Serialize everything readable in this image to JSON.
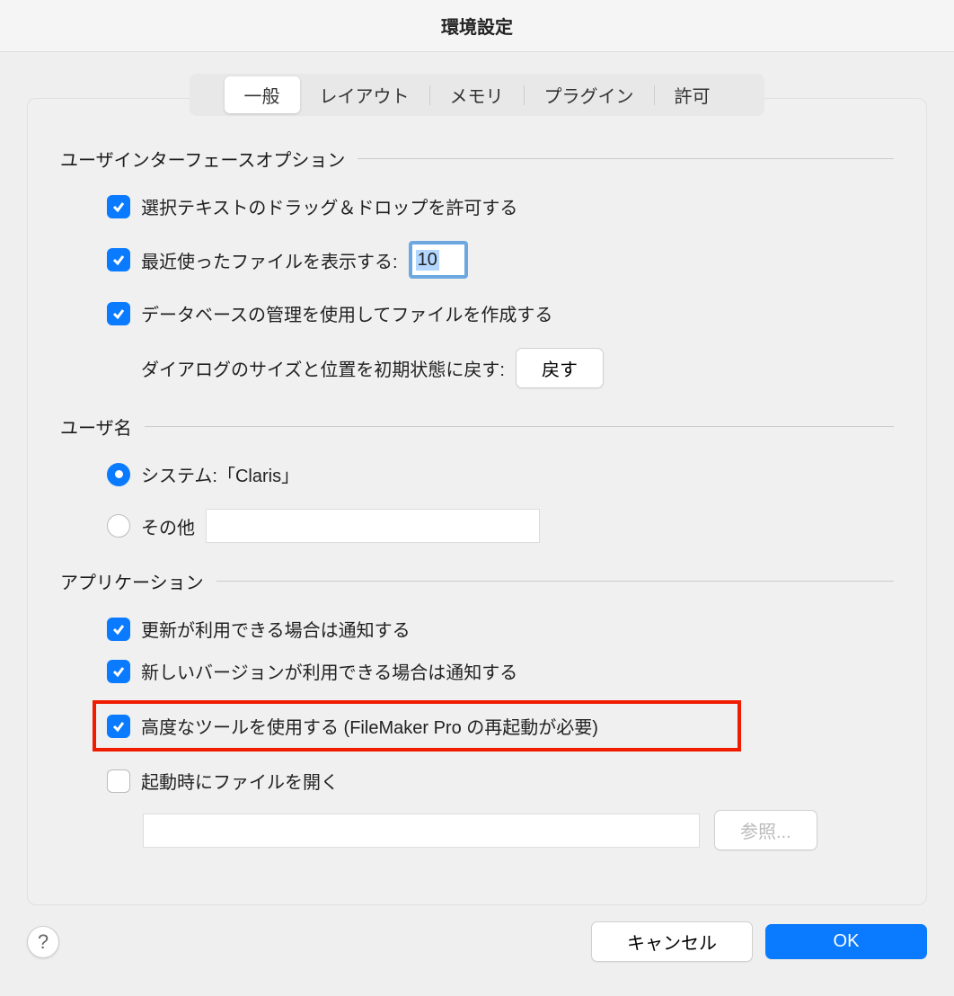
{
  "window": {
    "title": "環境設定"
  },
  "tabs": {
    "general": "一般",
    "layout": "レイアウト",
    "memory": "メモリ",
    "plugins": "プラグイン",
    "permit": "許可"
  },
  "section_ui": {
    "title": "ユーザインターフェースオプション",
    "allow_drag_drop": "選択テキストのドラッグ＆ドロップを許可する",
    "show_recent_label": "最近使ったファイルを表示する:",
    "recent_value": "10",
    "create_with_manage": "データベースの管理を使用してファイルを作成する",
    "reset_dialog_label": "ダイアログのサイズと位置を初期状態に戻す:",
    "reset_button": "戻す"
  },
  "section_user": {
    "title": "ユーザ名",
    "system_label": "システム:「Claris」",
    "other_label": "その他",
    "other_value": ""
  },
  "section_app": {
    "title": "アプリケーション",
    "notify_update": "更新が利用できる場合は通知する",
    "notify_new_version": "新しいバージョンが利用できる場合は通知する",
    "advanced_tools": "高度なツールを使用する (FileMaker Pro の再起動が必要)",
    "open_on_startup": "起動時にファイルを開く",
    "startup_path": "",
    "browse_button": "参照..."
  },
  "footer": {
    "help": "?",
    "cancel": "キャンセル",
    "ok": "OK"
  }
}
